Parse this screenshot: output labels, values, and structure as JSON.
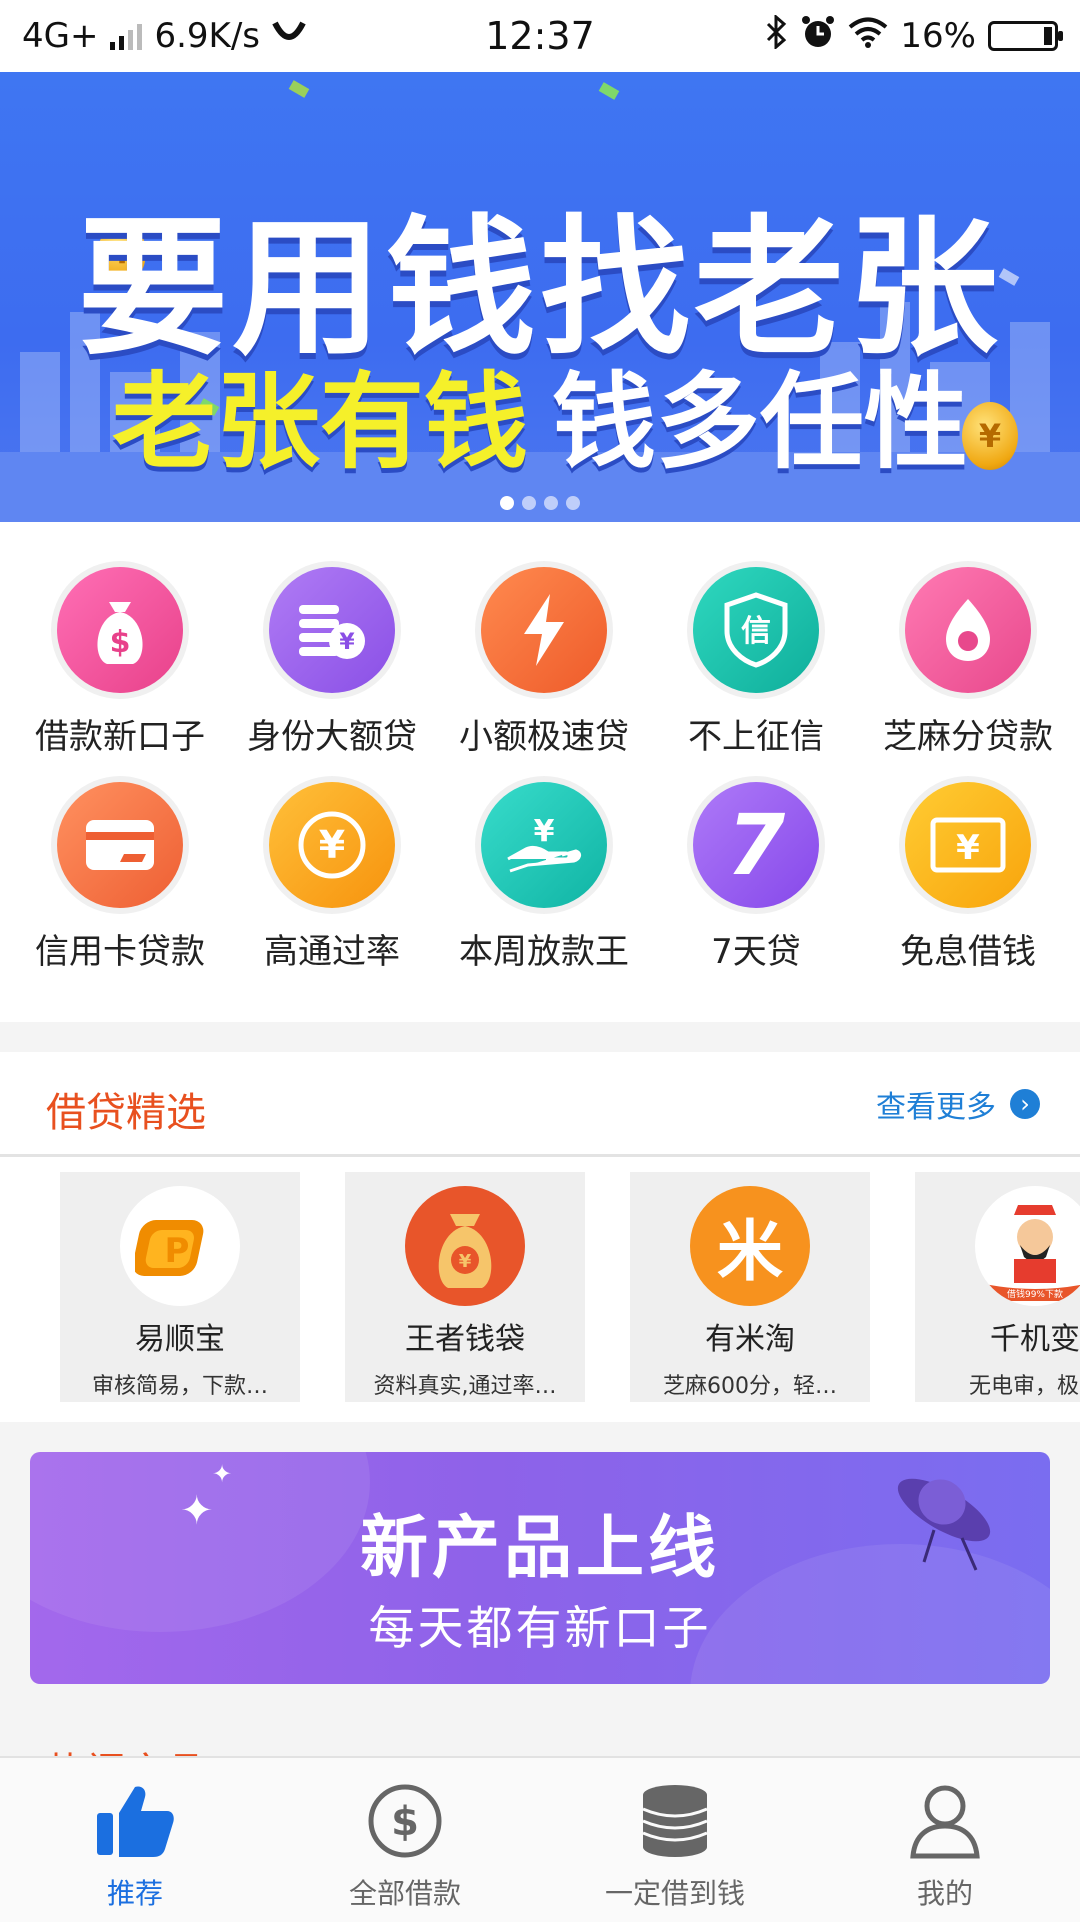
{
  "status_bar": {
    "network": "4G+",
    "speed": "6.9K/s",
    "time": "12:37",
    "battery": "16%"
  },
  "banner": {
    "title": "要用钱找老张",
    "subtitle_yellow": "老张有钱",
    "subtitle_white": "钱多任性",
    "coin_symbol": "¥",
    "pages": 4,
    "active_page": 1
  },
  "categories": [
    {
      "label": "借款新口子",
      "icon": "money-bag-icon",
      "color": "#f0569c"
    },
    {
      "label": "身份大额贷",
      "icon": "coins-icon",
      "color": "#9a63ea"
    },
    {
      "label": "小额极速贷",
      "icon": "lightning-icon",
      "color": "#f46f3a"
    },
    {
      "label": "不上征信",
      "icon": "shield-xin-icon",
      "color": "#16c3ad"
    },
    {
      "label": "芝麻分贷款",
      "icon": "sesame-icon",
      "color": "#ee5c9a"
    },
    {
      "label": "信用卡贷款",
      "icon": "credit-card-icon",
      "color": "#f5784a"
    },
    {
      "label": "高通过率",
      "icon": "yen-circle-icon",
      "color": "#fba31a"
    },
    {
      "label": "本周放款王",
      "icon": "hand-yen-icon",
      "color": "#1bc6b6"
    },
    {
      "label": "7天贷",
      "icon": "seven-icon",
      "color": "#9b5ff0"
    },
    {
      "label": "免息借钱",
      "icon": "yen-bill-icon",
      "color": "#fbb215"
    }
  ],
  "icon_glyphs": {
    "sesame": "●",
    "yen": "¥",
    "xin": "信",
    "seven": "7",
    "dollar": "$"
  },
  "featured": {
    "title": "借贷精选",
    "more": "查看更多",
    "more_arrow": "›",
    "items": [
      {
        "name": "易顺宝",
        "desc": "审核简易，下款…",
        "logo": "yishunbao-logo"
      },
      {
        "name": "王者钱袋",
        "desc": "资料真实,通过率…",
        "logo": "wangzhe-money-bag-logo"
      },
      {
        "name": "有米淘",
        "desc": "芝麻600分，轻…",
        "logo": "youmitao-logo"
      },
      {
        "name": "千机变",
        "desc": "无电审，极速",
        "logo": "qianjibian-logo"
      }
    ],
    "logo_texts": {
      "yishunbao": "P",
      "youmitao": "米",
      "qianjibian_ribbon": "借钱99%下款"
    }
  },
  "promo": {
    "title": "新产品上线",
    "subtitle": "每天都有新口子"
  },
  "next_section_title": "热门产品",
  "tabs": [
    {
      "label": "推荐",
      "icon": "thumbs-up-icon",
      "active": true
    },
    {
      "label": "全部借款",
      "icon": "dollar-circle-icon",
      "active": false
    },
    {
      "label": "一定借到钱",
      "icon": "coin-stack-icon",
      "active": false
    },
    {
      "label": "我的",
      "icon": "user-icon",
      "active": false
    }
  ]
}
